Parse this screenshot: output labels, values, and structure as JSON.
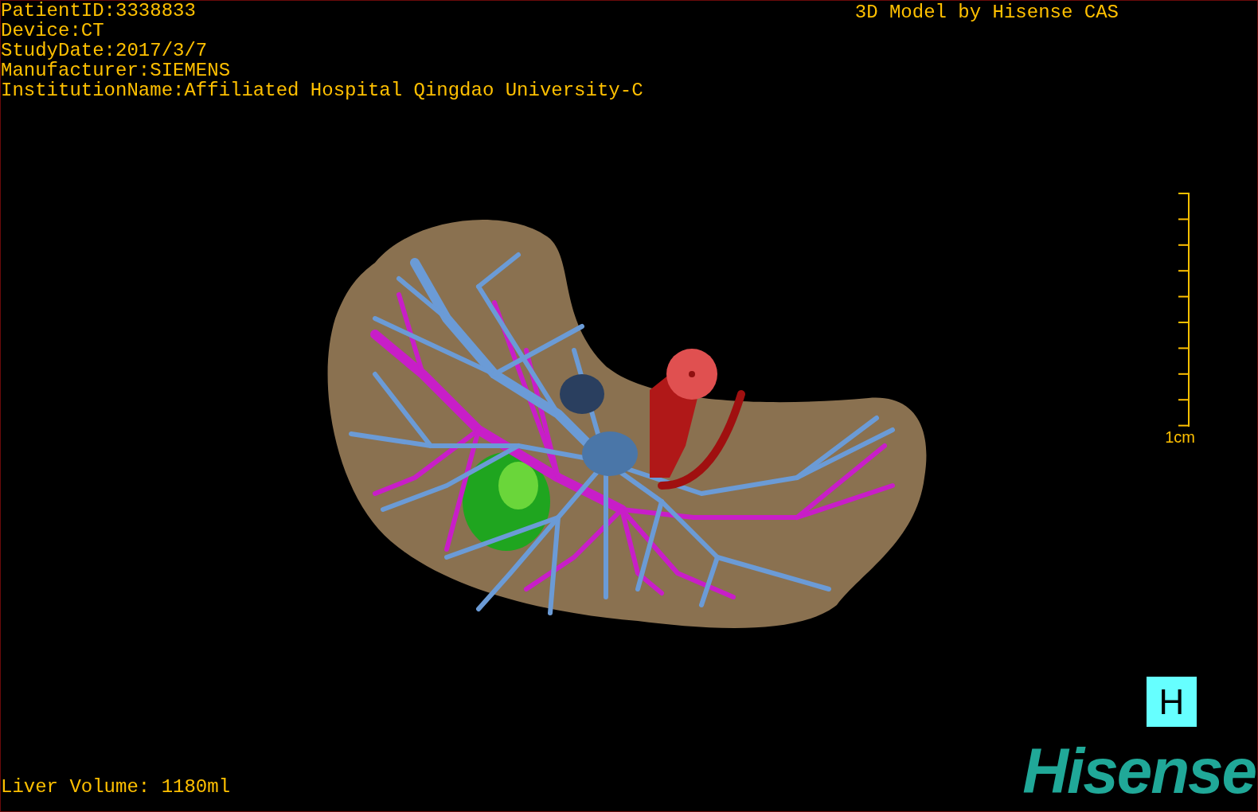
{
  "info_lines": [
    "PatientID:3338833",
    "Device:CT",
    "StudyDate:2017/3/7",
    "Manufacturer:SIEMENS",
    "InstitutionName:Affiliated Hospital Qingdao University-C"
  ],
  "credit": "3D Model by Hisense CAS",
  "scale_bar": {
    "label": "1cm"
  },
  "liver_volume": "Liver Volume: 1180ml",
  "view_button": {
    "label": "H"
  },
  "logo": "Hisense"
}
